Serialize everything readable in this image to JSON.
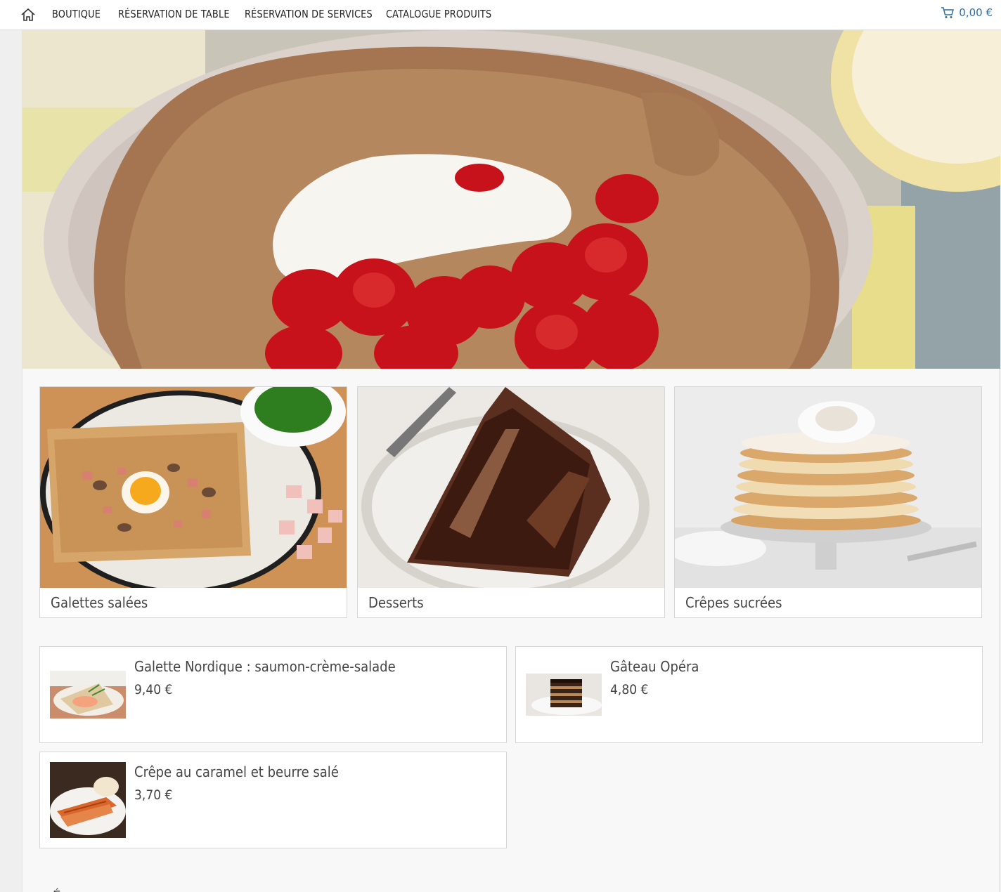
{
  "nav": {
    "home_icon": "home-icon",
    "items": [
      {
        "label": "BOUTIQUE"
      },
      {
        "label": "RÉSERVATION DE TABLE"
      },
      {
        "label": "RÉSERVATION DE SERVICES"
      },
      {
        "label": "CATALOGUE PRODUITS"
      }
    ],
    "cart": {
      "icon": "cart-icon",
      "total": "0,00 €"
    }
  },
  "colors": {
    "accent": "#2f6da0",
    "panel": "#f8f8f8",
    "border": "#d6d6d6"
  },
  "categories": [
    {
      "label": "Galettes salées"
    },
    {
      "label": "Desserts"
    },
    {
      "label": "Crêpes sucrées"
    }
  ],
  "products": [
    {
      "name": "Galette Nordique : saumon-crème-salade",
      "price": "9,40 €"
    },
    {
      "name": "Gâteau Opéra",
      "price": "4,80 €"
    },
    {
      "name": "Crêpe au caramel et beurre salé",
      "price": "3,70 €"
    }
  ],
  "partial_heading": "É"
}
